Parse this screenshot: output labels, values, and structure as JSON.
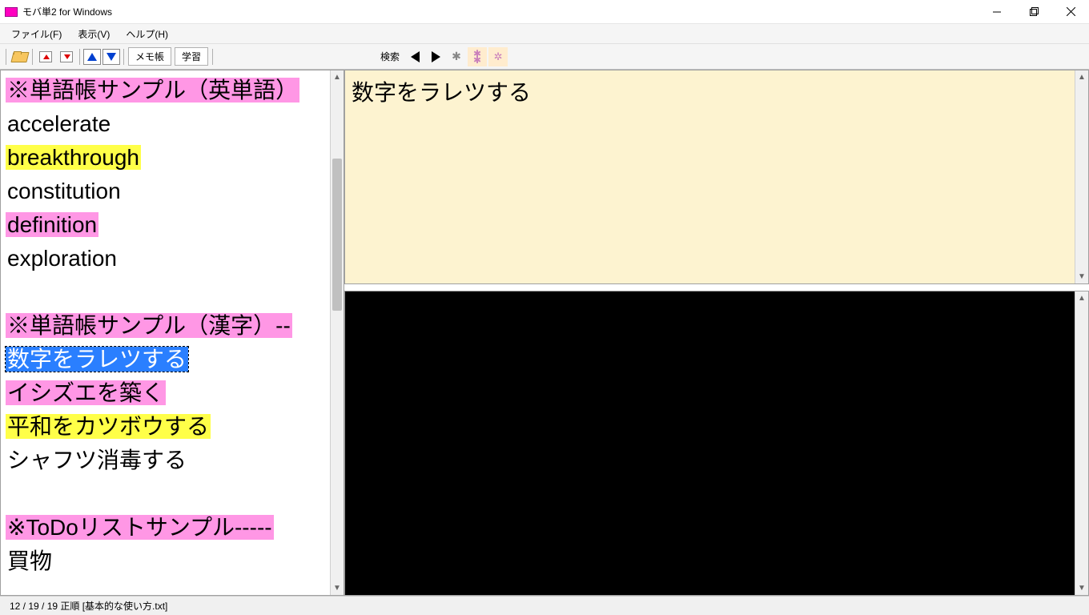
{
  "window": {
    "title": "モバ単2 for Windows"
  },
  "menu": {
    "file": "ファイル(F)",
    "view": "表示(V)",
    "help": "ヘルプ(H)"
  },
  "toolbar": {
    "memo": "メモ帳",
    "study": "学習",
    "search": "検索"
  },
  "list": {
    "items": [
      {
        "text": "※単語帳サンプル（英単語）",
        "hl": "pink"
      },
      {
        "text": "accelerate",
        "hl": ""
      },
      {
        "text": "breakthrough",
        "hl": "yellow"
      },
      {
        "text": "constitution",
        "hl": ""
      },
      {
        "text": "definition",
        "hl": "pink"
      },
      {
        "text": "exploration",
        "hl": ""
      },
      {
        "text": "",
        "hl": ""
      },
      {
        "text": "※単語帳サンプル（漢字）--",
        "hl": "pink"
      },
      {
        "text": "数字をラレツする",
        "hl": "blue"
      },
      {
        "text": "イシズエを築く",
        "hl": "pink"
      },
      {
        "text": "平和をカツボウする",
        "hl": "yellow"
      },
      {
        "text": "シャフツ消毒する",
        "hl": ""
      },
      {
        "text": "",
        "hl": ""
      },
      {
        "text": "※ToDoリストサンプル-----",
        "hl": "pink"
      },
      {
        "text": "買物",
        "hl": ""
      }
    ]
  },
  "detail": {
    "top": "数字をラレツする"
  },
  "status": {
    "text": "12 / 19 / 19 正順 [基本的な使い方.txt]"
  }
}
